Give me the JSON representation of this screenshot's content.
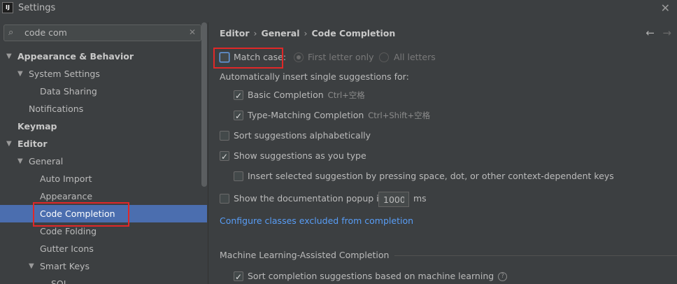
{
  "window": {
    "title": "Settings",
    "logo": "IJ",
    "close_icon": "close-icon"
  },
  "search": {
    "value": "code com"
  },
  "tree": {
    "appearance_behavior": "Appearance & Behavior",
    "system_settings": "System Settings",
    "data_sharing": "Data Sharing",
    "notifications": "Notifications",
    "keymap": "Keymap",
    "editor": "Editor",
    "general": "General",
    "auto_import": "Auto Import",
    "appearance": "Appearance",
    "code_completion": "Code Completion",
    "code_folding": "Code Folding",
    "gutter_icons": "Gutter Icons",
    "smart_keys": "Smart Keys",
    "sql": "SQL"
  },
  "breadcrumb": {
    "editor": "Editor",
    "general": "General",
    "page": "Code Completion"
  },
  "options": {
    "match_case": "Match case:",
    "first_letter": "First letter only",
    "all_letters": "All letters",
    "auto_insert_heading": "Automatically insert single suggestions for:",
    "basic_completion": "Basic Completion",
    "basic_shortcut": "Ctrl+空格",
    "type_matching": "Type-Matching Completion",
    "type_matching_shortcut": "Ctrl+Shift+空格",
    "sort_alpha": "Sort suggestions alphabetically",
    "show_as_type": "Show suggestions as you type",
    "insert_selected": "Insert selected suggestion by pressing space, dot, or other context-dependent keys",
    "show_doc_popup": "Show the documentation popup in",
    "doc_popup_ms": "1000",
    "ms_unit": "ms",
    "configure_link": "Configure classes excluded from completion",
    "ml_section": "Machine Learning-Assisted Completion",
    "ml_sort": "Sort completion suggestions based on machine learning",
    "help_glyph": "?"
  },
  "states": {
    "match_case_checked": false,
    "basic_checked": true,
    "type_matching_checked": true,
    "sort_alpha_checked": false,
    "show_as_type_checked": true,
    "insert_selected_checked": false,
    "show_doc_checked": false,
    "ml_sort_checked": true
  },
  "colors": {
    "background": "#3c3f41",
    "selection": "#4b6eaf",
    "link": "#589df6",
    "highlight": "#e02828"
  }
}
